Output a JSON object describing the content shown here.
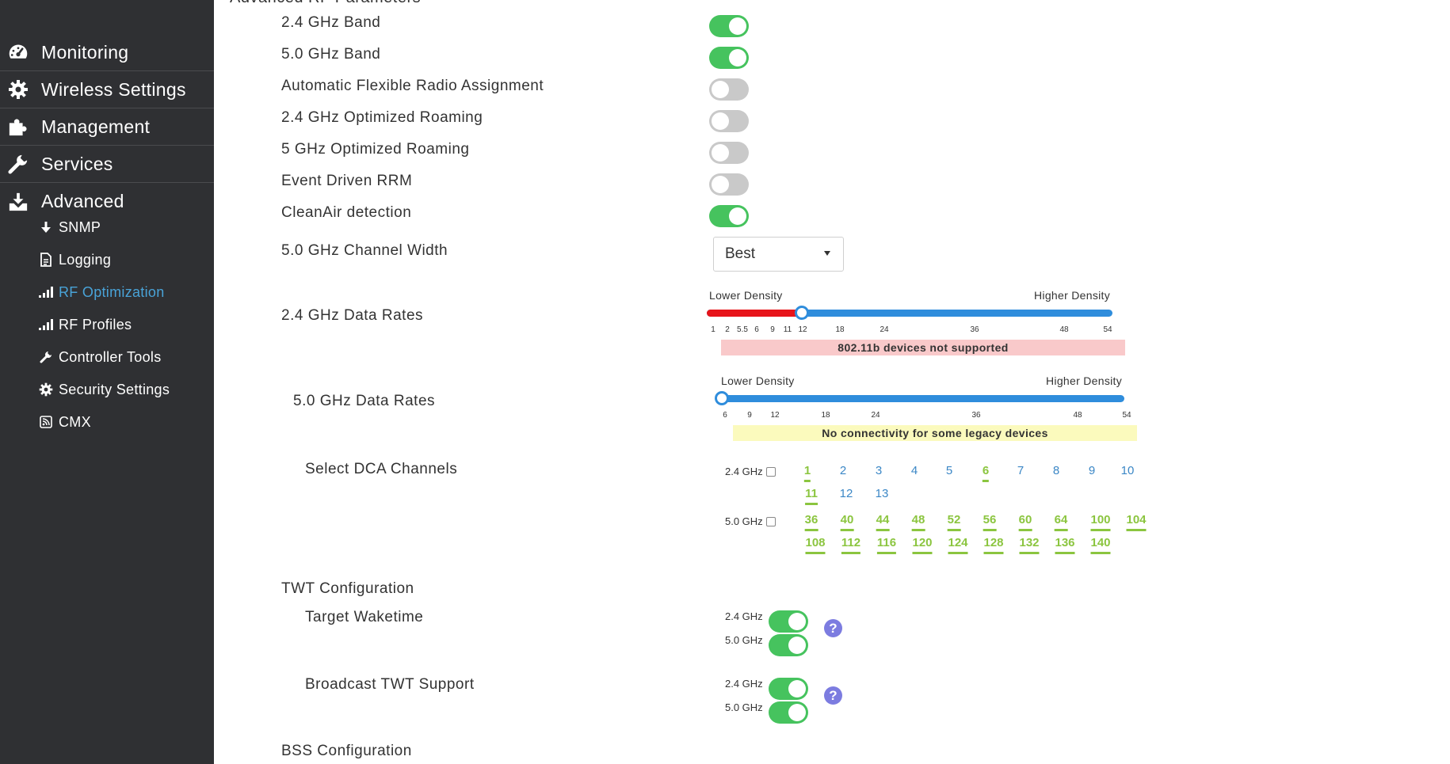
{
  "sidebar": {
    "main_items": [
      {
        "label": "Monitoring",
        "icon": "dashboard-icon"
      },
      {
        "label": "Wireless Settings",
        "icon": "gear-icon"
      },
      {
        "label": "Management",
        "icon": "puzzle-icon"
      },
      {
        "label": "Services",
        "icon": "wrench-icon"
      },
      {
        "label": "Advanced",
        "icon": "download-icon"
      }
    ],
    "sub_items": [
      {
        "label": "SNMP",
        "icon": "arrow-down-icon"
      },
      {
        "label": "Logging",
        "icon": "document-icon"
      },
      {
        "label": "RF Optimization",
        "icon": "signal-bars-icon",
        "active": true
      },
      {
        "label": "RF Profiles",
        "icon": "signal-bars-icon"
      },
      {
        "label": "Controller Tools",
        "icon": "wrench-icon"
      },
      {
        "label": "Security Settings",
        "icon": "gear-icon"
      },
      {
        "label": "CMX",
        "icon": "rss-icon"
      }
    ]
  },
  "main": {
    "section_title": "Advanced RF Parameters",
    "toggles": [
      {
        "label": "2.4 GHz Band",
        "on": true
      },
      {
        "label": "5.0 GHz Band",
        "on": true
      },
      {
        "label": "Automatic Flexible Radio Assignment",
        "on": false
      },
      {
        "label": "2.4 GHz Optimized Roaming",
        "on": false
      },
      {
        "label": "5 GHz Optimized Roaming",
        "on": false
      },
      {
        "label": "Event Driven RRM",
        "on": false
      },
      {
        "label": "CleanAir detection",
        "on": true
      }
    ],
    "channel_width": {
      "label": "5.0 GHz Channel Width",
      "value": "Best"
    },
    "rates24": {
      "label": "2.4 GHz Data Rates",
      "lower": "Lower Density",
      "higher": "Higher Density",
      "ticks": [
        "1",
        "2",
        "5.5",
        "6",
        "9",
        "11",
        "12",
        "18",
        "24",
        "36",
        "48",
        "54"
      ],
      "selected": "12",
      "banner": "802.11b devices not supported"
    },
    "rates50": {
      "label": "5.0 GHz Data Rates",
      "lower": "Lower Density",
      "higher": "Higher Density",
      "ticks": [
        "6",
        "9",
        "12",
        "18",
        "24",
        "36",
        "48",
        "54"
      ],
      "selected": "6",
      "banner": "No connectivity for some legacy devices"
    },
    "dca": {
      "label": "Select DCA Channels",
      "band24": "2.4 GHz",
      "band50": "5.0 GHz",
      "channels24": [
        {
          "ch": "1",
          "sel": true
        },
        {
          "ch": "2",
          "sel": false
        },
        {
          "ch": "3",
          "sel": false
        },
        {
          "ch": "4",
          "sel": false
        },
        {
          "ch": "5",
          "sel": false
        },
        {
          "ch": "6",
          "sel": true
        },
        {
          "ch": "7",
          "sel": false
        },
        {
          "ch": "8",
          "sel": false
        },
        {
          "ch": "9",
          "sel": false
        },
        {
          "ch": "10",
          "sel": false
        },
        {
          "ch": "11",
          "sel": true
        },
        {
          "ch": "12",
          "sel": false
        },
        {
          "ch": "13",
          "sel": false
        }
      ],
      "channels50": [
        "36",
        "40",
        "44",
        "48",
        "52",
        "56",
        "60",
        "64",
        "100",
        "104",
        "108",
        "112",
        "116",
        "120",
        "124",
        "128",
        "132",
        "136",
        "140"
      ]
    },
    "twt": {
      "title": "TWT Configuration",
      "target": {
        "label": "Target Waketime",
        "band24": "2.4 GHz",
        "band50": "5.0 GHz"
      },
      "broadcast": {
        "label": "Broadcast TWT Support",
        "band24": "2.4 GHz",
        "band50": "5.0 GHz"
      }
    },
    "bss": {
      "title": "BSS Configuration"
    }
  }
}
